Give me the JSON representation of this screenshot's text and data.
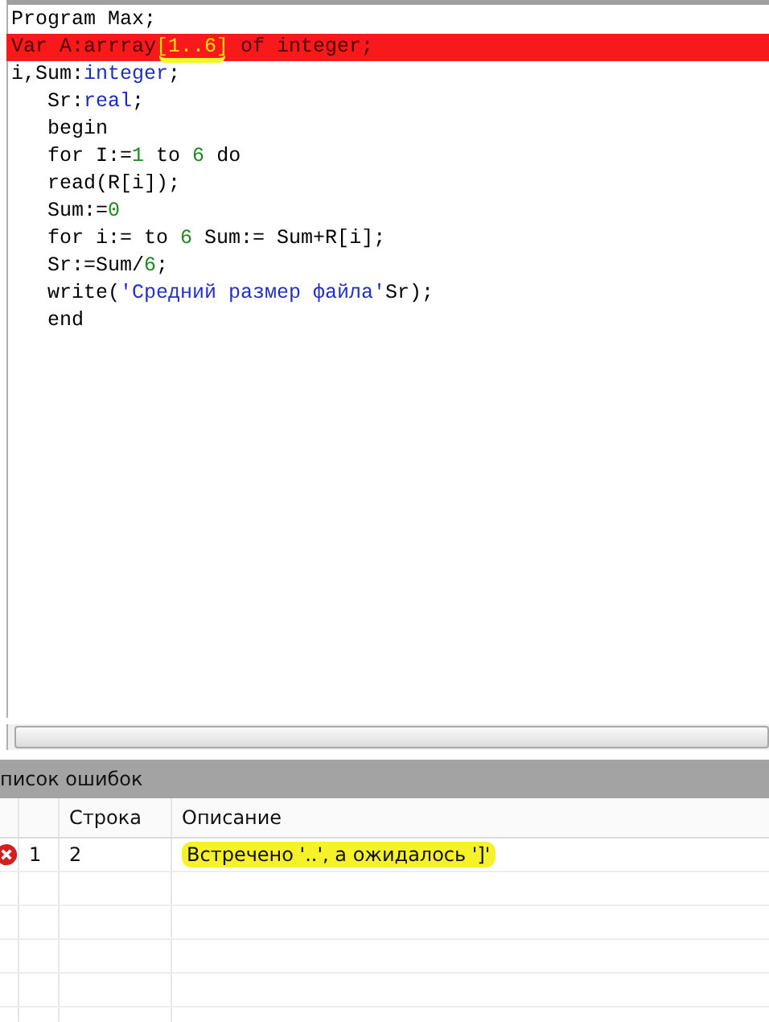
{
  "editor": {
    "lines": [
      {
        "error": false,
        "tokens": [
          {
            "kind": "plain",
            "text": "Program Max;"
          }
        ]
      },
      {
        "error": true,
        "tokens": [
          {
            "kind": "plain",
            "text": "Var A:arrray"
          },
          {
            "kind": "plain",
            "text": "[1..6]",
            "highlighted": true
          },
          {
            "kind": "plain",
            "text": " of integer;"
          }
        ]
      },
      {
        "error": false,
        "tokens": [
          {
            "kind": "plain",
            "text": "i,Sum:"
          },
          {
            "kind": "type",
            "text": "integer"
          },
          {
            "kind": "plain",
            "text": ";"
          }
        ]
      },
      {
        "error": false,
        "tokens": [
          {
            "kind": "plain",
            "text": "   Sr:"
          },
          {
            "kind": "type",
            "text": "real"
          },
          {
            "kind": "plain",
            "text": ";"
          }
        ]
      },
      {
        "error": false,
        "tokens": [
          {
            "kind": "plain",
            "text": "   begin"
          }
        ]
      },
      {
        "error": false,
        "tokens": [
          {
            "kind": "plain",
            "text": "   for I:="
          },
          {
            "kind": "number",
            "text": "1"
          },
          {
            "kind": "plain",
            "text": " to "
          },
          {
            "kind": "number",
            "text": "6"
          },
          {
            "kind": "plain",
            "text": " do"
          }
        ]
      },
      {
        "error": false,
        "tokens": [
          {
            "kind": "plain",
            "text": "   read(R[i]);"
          }
        ]
      },
      {
        "error": false,
        "tokens": [
          {
            "kind": "plain",
            "text": "   Sum:="
          },
          {
            "kind": "number",
            "text": "0"
          }
        ]
      },
      {
        "error": false,
        "tokens": [
          {
            "kind": "plain",
            "text": "   for i:= to "
          },
          {
            "kind": "number",
            "text": "6"
          },
          {
            "kind": "plain",
            "text": " Sum:= Sum+R[i];"
          }
        ]
      },
      {
        "error": false,
        "tokens": [
          {
            "kind": "plain",
            "text": "   Sr:=Sum/"
          },
          {
            "kind": "number",
            "text": "6"
          },
          {
            "kind": "plain",
            "text": ";"
          }
        ]
      },
      {
        "error": false,
        "tokens": [
          {
            "kind": "plain",
            "text": "   write("
          },
          {
            "kind": "string",
            "text": "'Средний размер файла'"
          },
          {
            "kind": "plain",
            "text": "Sr);"
          }
        ]
      },
      {
        "error": false,
        "tokens": [
          {
            "kind": "plain",
            "text": "   end"
          }
        ]
      }
    ]
  },
  "error_panel": {
    "title": "писок ошибок",
    "columns": [
      "Строка",
      "Описание"
    ],
    "rows": [
      {
        "kind": "error",
        "number": "1",
        "line": "2",
        "description": "Встречено '..', а ожидалось ']'",
        "highlighted": true
      }
    ]
  }
}
